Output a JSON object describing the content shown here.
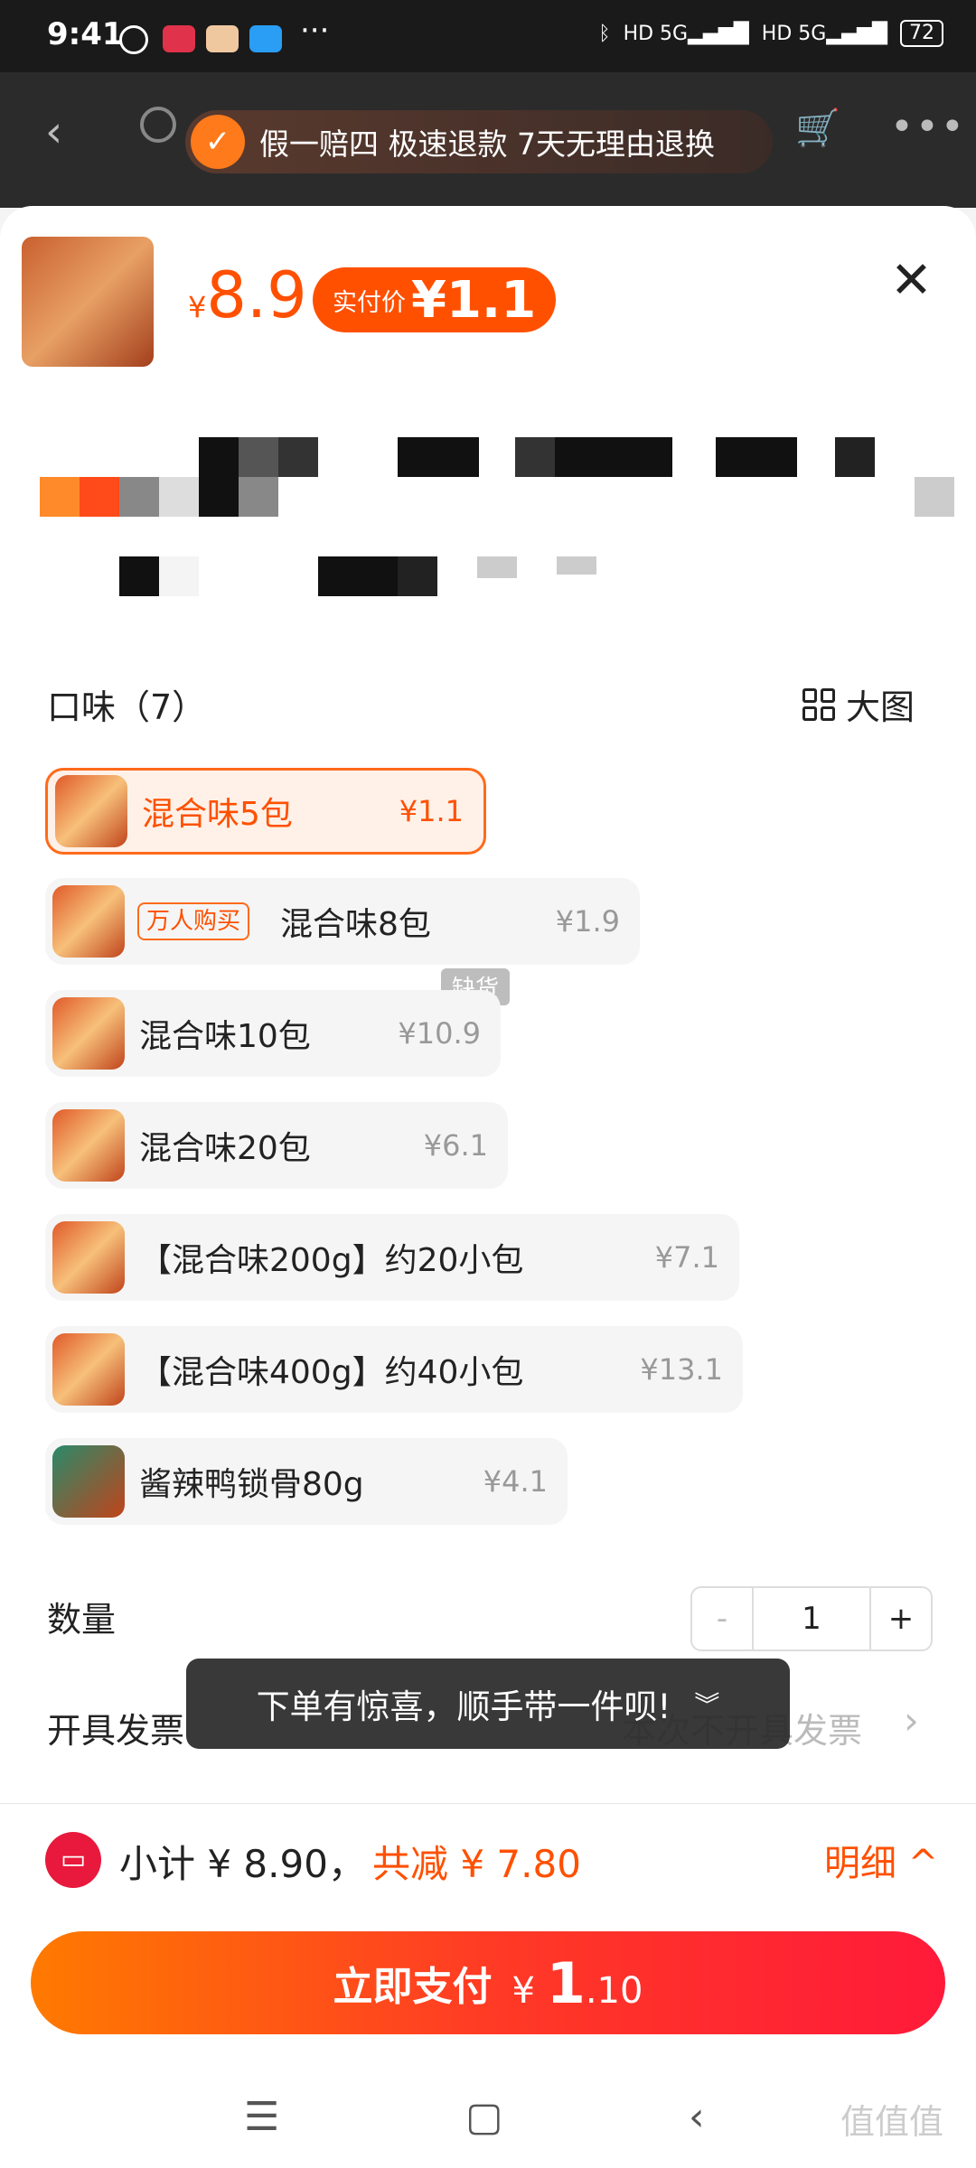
{
  "status_bar": {
    "time": "9:41",
    "battery": "72",
    "network": "5G"
  },
  "header": {
    "promo_text": "假一赔四 极速退款 7天无理由退换"
  },
  "sheet": {
    "price_currency": "¥",
    "price": "8.9",
    "pay_badge_label": "实付价",
    "pay_badge_value": "¥1.1"
  },
  "spec": {
    "title": "口味（7）",
    "big_image_label": "大图",
    "options": [
      {
        "name": "混合味5包",
        "price": "¥1.1",
        "selected": true,
        "tag": ""
      },
      {
        "name": "混合味8包",
        "price": "¥1.9",
        "selected": false,
        "tag": "万人购买"
      },
      {
        "name": "混合味10包",
        "price": "¥10.9",
        "selected": false,
        "tag": ""
      },
      {
        "name": "混合味20包",
        "price": "¥6.1",
        "selected": false,
        "tag": ""
      },
      {
        "name": "【混合味200g】约20小包",
        "price": "¥7.1",
        "selected": false,
        "tag": ""
      },
      {
        "name": "【混合味400g】约40小包",
        "price": "¥13.1",
        "selected": false,
        "tag": ""
      },
      {
        "name": "酱辣鸭锁骨80g",
        "price": "¥4.1",
        "selected": false,
        "tag": ""
      }
    ],
    "out_of_stock_label": "缺货"
  },
  "quantity": {
    "label": "数量",
    "value": "1",
    "minus": "-",
    "plus": "+"
  },
  "invoice": {
    "label": "开具发票",
    "value": "本次不开具发票"
  },
  "toast": {
    "text": "下单有惊喜，顺手带一件呗!"
  },
  "footer": {
    "subtotal": "小计 ¥ 8.90，",
    "reduce": "共减 ¥ 7.80",
    "detail": "明细 ^",
    "pay_label": "立即支付",
    "pay_currency": "¥",
    "pay_int": "1",
    "pay_dec": ".10"
  },
  "watermark": "值值值"
}
